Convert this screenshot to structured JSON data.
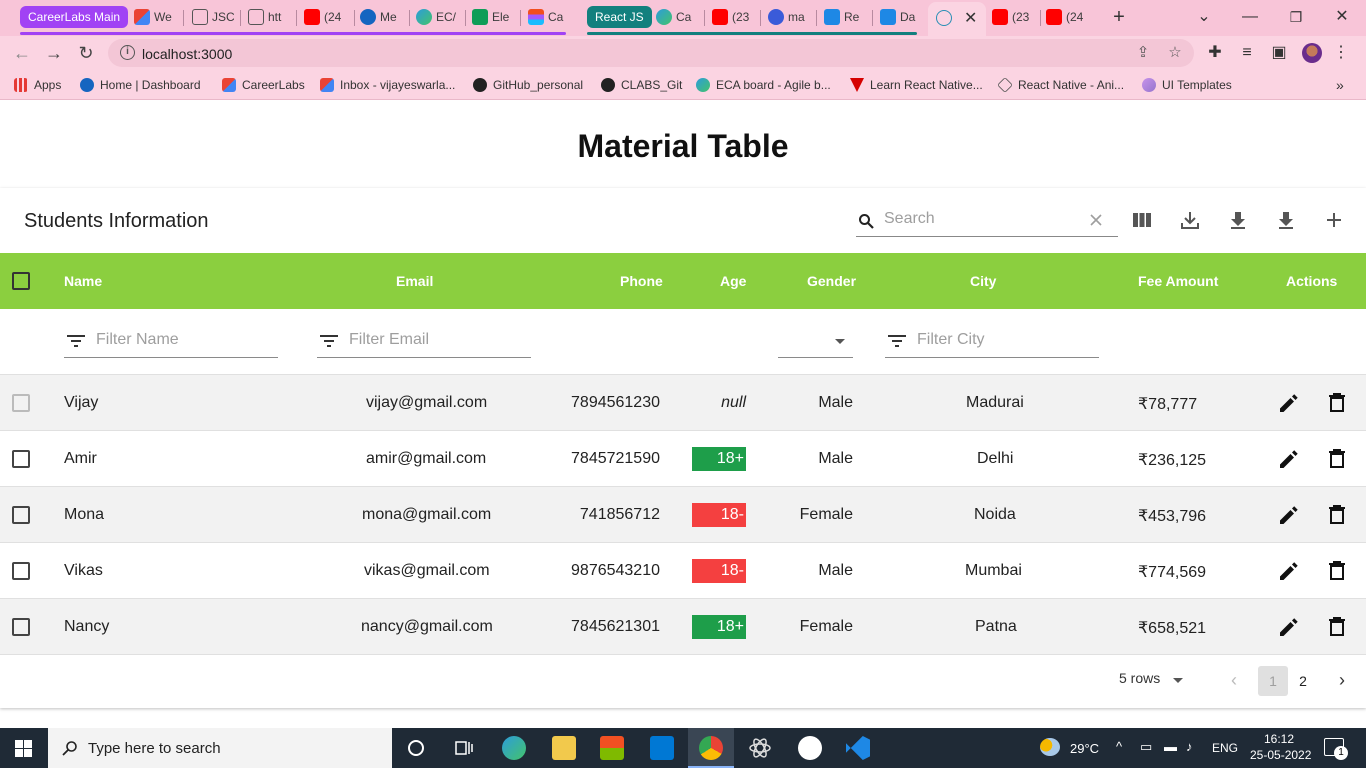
{
  "browser": {
    "tabs": [
      {
        "label": "CareerLabs Main",
        "type": "group"
      },
      {
        "label": "We",
        "icon": "gmail-icon"
      },
      {
        "label": "JSC",
        "icon": "page-icon"
      },
      {
        "label": "htt",
        "icon": "page-icon"
      },
      {
        "label": "(24",
        "icon": "youtube-icon"
      },
      {
        "label": "Me",
        "icon": "k-icon"
      },
      {
        "label": "EC/",
        "icon": "edge-icon"
      },
      {
        "label": "Ele",
        "icon": "sheets-icon"
      },
      {
        "label": "Ca",
        "icon": "figma-icon"
      },
      {
        "label": "React JS",
        "type": "group"
      },
      {
        "label": "Ca",
        "icon": "edge-icon"
      },
      {
        "label": "(23",
        "icon": "youtube-icon"
      },
      {
        "label": "ma",
        "icon": "globe-icon"
      },
      {
        "label": "Re",
        "icon": "mui-icon"
      },
      {
        "label": "Da",
        "icon": "mui-icon"
      },
      {
        "label": "",
        "icon": "react-icon",
        "active": true
      },
      {
        "label": "(23",
        "icon": "youtube-icon"
      },
      {
        "label": "(24",
        "icon": "youtube-icon"
      }
    ],
    "url": "localhost:3000",
    "bookmarks": [
      {
        "label": "Apps"
      },
      {
        "label": "Home | Dashboard"
      },
      {
        "label": "CareerLabs"
      },
      {
        "label": "Inbox - vijayeswarla..."
      },
      {
        "label": "GitHub_personal"
      },
      {
        "label": "CLABS_Git"
      },
      {
        "label": "ECA board - Agile b..."
      },
      {
        "label": "Learn React Native..."
      },
      {
        "label": "React Native - Ani..."
      },
      {
        "label": "UI Templates"
      }
    ],
    "colors": {
      "group_careerlabs": "#a142f4",
      "group_react": "#12807e"
    }
  },
  "page": {
    "title": "Material Table",
    "table_title": "Students Information",
    "search_placeholder": "Search",
    "accent": "#8bcf3f",
    "columns": [
      "Name",
      "Email",
      "Phone",
      "Age",
      "Gender",
      "City",
      "Fee Amount",
      "Actions"
    ],
    "filters": {
      "name_placeholder": "Filter Name",
      "email_placeholder": "Filter Email",
      "city_placeholder": "Filter City"
    },
    "rows": [
      {
        "name": "Vijay",
        "email": "vijay@gmail.com",
        "phone": "7894561230",
        "age": "null",
        "age_status": "none",
        "gender": "Male",
        "city": "Madurai",
        "fee": "₹78,777"
      },
      {
        "name": "Amir",
        "email": "amir@gmail.com",
        "phone": "7845721590",
        "age": "18+",
        "age_status": "adult",
        "gender": "Male",
        "city": "Delhi",
        "fee": "₹236,125"
      },
      {
        "name": "Mona",
        "email": "mona@gmail.com",
        "phone": "741856712",
        "age": "18-",
        "age_status": "minor",
        "gender": "Female",
        "city": "Noida",
        "fee": "₹453,796"
      },
      {
        "name": "Vikas",
        "email": "vikas@gmail.com",
        "phone": "9876543210",
        "age": "18-",
        "age_status": "minor",
        "gender": "Male",
        "city": "Mumbai",
        "fee": "₹774,569"
      },
      {
        "name": "Nancy",
        "email": "nancy@gmail.com",
        "phone": "7845621301",
        "age": "18+",
        "age_status": "adult",
        "gender": "Female",
        "city": "Patna",
        "fee": "₹658,521"
      }
    ],
    "badge_colors": {
      "adult": "#1e9e4a",
      "minor": "#f44040"
    },
    "pagination": {
      "rows_per_page": "5 rows",
      "pages": [
        "1",
        "2"
      ],
      "current_page": "1"
    }
  },
  "taskbar": {
    "search_placeholder": "Type here to search",
    "weather": "29°C",
    "language": "ENG",
    "time": "16:12",
    "date": "25-05-2022",
    "notification_count": "1"
  }
}
